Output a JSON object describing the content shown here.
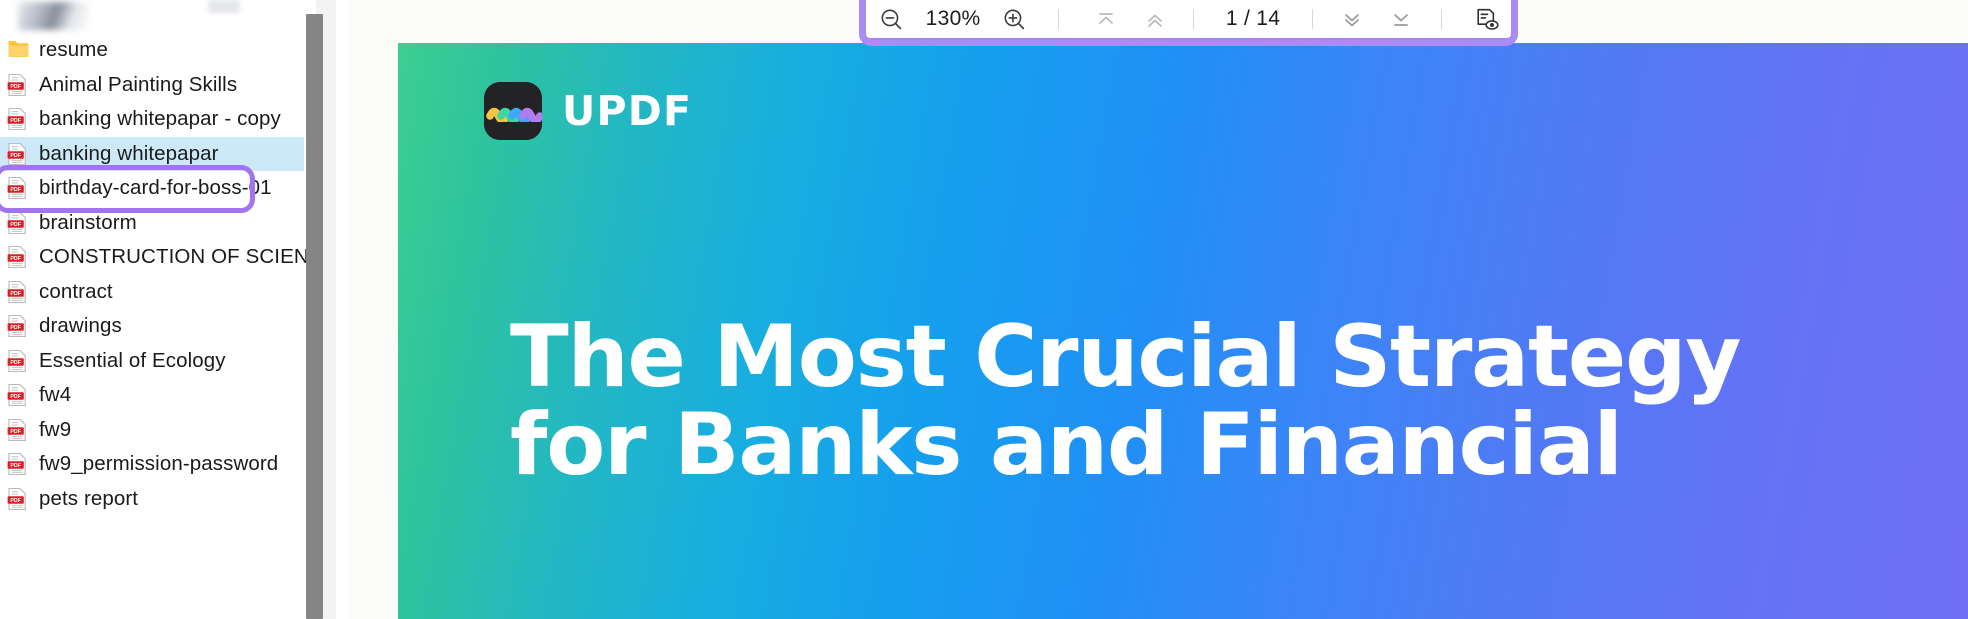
{
  "sidebar": {
    "files": [
      {
        "name": "resume",
        "icon": "folder-icon",
        "type": "folder",
        "selected": false
      },
      {
        "name": "Animal Painting Skills",
        "icon": "pdf-file-icon",
        "type": "pdf",
        "selected": false
      },
      {
        "name": "banking whitepapar - copy",
        "icon": "pdf-file-icon",
        "type": "pdf",
        "selected": false
      },
      {
        "name": "banking whitepapar",
        "icon": "pdf-file-icon",
        "type": "pdf",
        "selected": true
      },
      {
        "name": "birthday-card-for-boss-01",
        "icon": "pdf-file-icon",
        "type": "pdf",
        "selected": false
      },
      {
        "name": "brainstorm",
        "icon": "pdf-file-icon",
        "type": "pdf",
        "selected": false
      },
      {
        "name": "CONSTRUCTION OF SCIENCE",
        "icon": "pdf-file-icon",
        "type": "pdf",
        "selected": false
      },
      {
        "name": "contract",
        "icon": "pdf-file-icon",
        "type": "pdf",
        "selected": false
      },
      {
        "name": "drawings",
        "icon": "pdf-file-icon",
        "type": "pdf",
        "selected": false
      },
      {
        "name": "Essential of Ecology",
        "icon": "pdf-file-icon",
        "type": "pdf",
        "selected": false
      },
      {
        "name": "fw4",
        "icon": "pdf-file-icon",
        "type": "pdf",
        "selected": false
      },
      {
        "name": "fw9",
        "icon": "pdf-file-icon",
        "type": "pdf",
        "selected": false
      },
      {
        "name": "fw9_permission-password",
        "icon": "pdf-file-icon",
        "type": "pdf",
        "selected": false
      },
      {
        "name": "pets report",
        "icon": "pdf-file-icon",
        "type": "pdf",
        "selected": false
      }
    ],
    "scrollbar": {
      "name": "vertical-scrollbar"
    }
  },
  "toolbar": {
    "zoom_out_icon": "zoom-out-icon",
    "zoom_level": "130%",
    "zoom_in_icon": "zoom-in-icon",
    "first_page_icon": "first-page-icon",
    "previous_page_icon": "previous-page-icon",
    "page_indicator": "1 / 14",
    "current_page": "1",
    "page_separator": "/",
    "total_pages": "14",
    "next_page_icon": "next-page-icon",
    "last_page_icon": "last-page-icon",
    "view_mode_icon": "page-view-icon",
    "annotation_color": "#a98cf5"
  },
  "document": {
    "brand": "UPDF",
    "logo_icon": "updf-logo-icon",
    "title_line1": "The Most Crucial Strategy",
    "title_line2": "for Banks and Financial",
    "gradient_start": "#3ccf91",
    "gradient_mid": "#159fee",
    "gradient_end": "#7070f4",
    "logo_wave_colors": [
      "#f5c542",
      "#3fd6a0",
      "#3da8f5",
      "#b07cf0"
    ]
  },
  "annotations": {
    "selected_file_highlight_color": "#a274ef",
    "toolbar_highlight_color": "#a98cf5"
  }
}
